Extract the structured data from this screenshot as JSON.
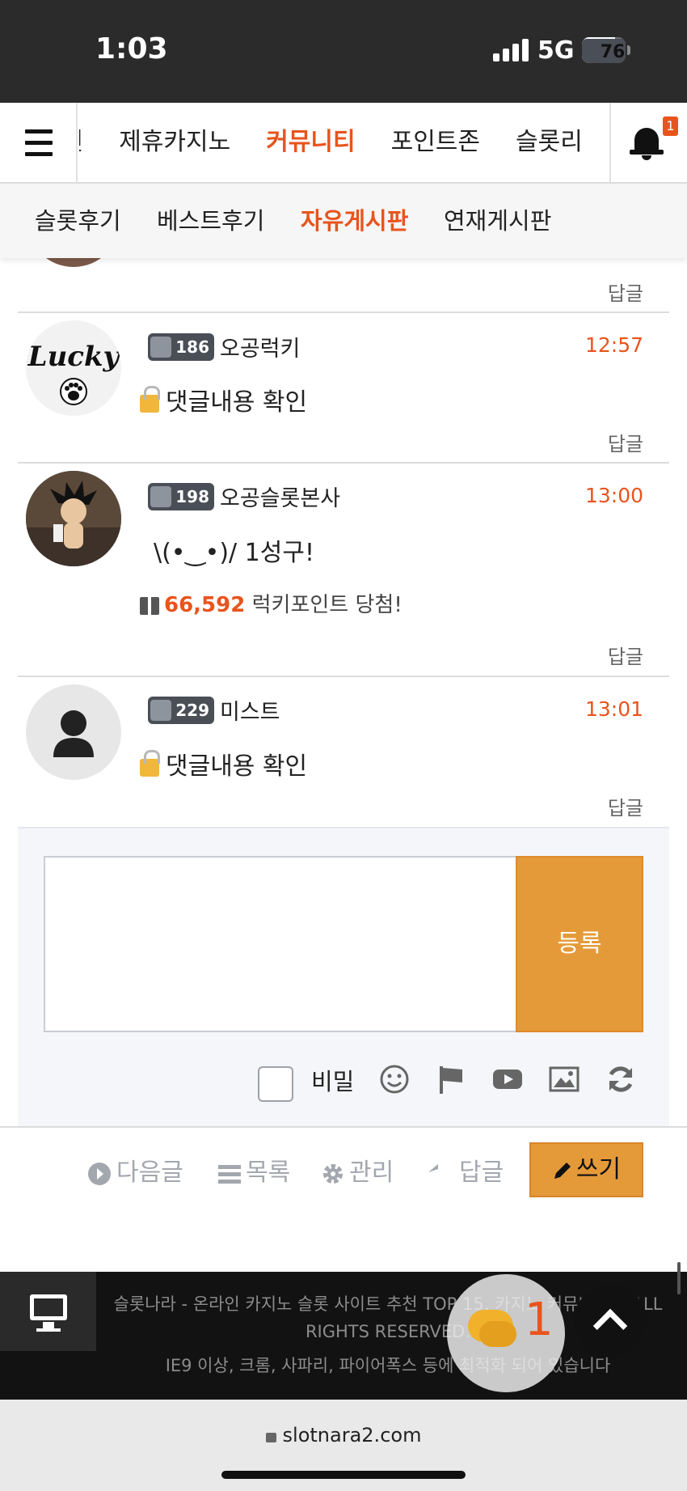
{
  "status": {
    "time": "1:03",
    "network": "5G",
    "battery": "76",
    "battery_level": 0.76
  },
  "nav": {
    "items": [
      "이인",
      "제휴카지노",
      "커뮤니티",
      "포인트존",
      "슬롯리"
    ],
    "active_index": 2,
    "notification_count": "1"
  },
  "subnav": {
    "items": [
      "슬롯후기",
      "베스트후기",
      "자유게시판",
      "연재게시판"
    ],
    "active_index": 2
  },
  "comments": [
    {
      "level": "186",
      "nickname": "오공럭키",
      "time": "12:57",
      "content": "댓글내용 확인",
      "locked": true,
      "reply": "답글"
    },
    {
      "level": "198",
      "nickname": "오공슬롯본사",
      "time": "13:00",
      "content": "\\(•‿•)/ 1성구!",
      "points": "66,592",
      "points_suffix": "럭키포인트 당첨!",
      "reply": "답글"
    },
    {
      "level": "229",
      "nickname": "미스트",
      "time": "13:01",
      "content": "댓글내용 확인",
      "locked": true,
      "reply": "답글"
    }
  ],
  "top_reply": "답글",
  "form": {
    "submit_label": "등록",
    "secret_label": "비밀",
    "textarea_placeholder": ""
  },
  "actions": {
    "next": "다음글",
    "list": "목록",
    "manage": "관리",
    "reply": "답글",
    "write": "쓰기"
  },
  "footer": {
    "line1": "슬롯나라 - 온라인 카지노 슬롯 사이트 추천 TOP 15, 카지노 커뮤니티 ©ALL",
    "line2": "RIGHTS RESERVED.",
    "line3": "IE9 이상, 크롬, 사파리, 파이어폭스 등에 최적화 되어 있습니다",
    "chat_count": "1"
  },
  "url": "slotnara2.com",
  "colors": {
    "accent": "#e8541c",
    "button": "#e59a3a",
    "dark": "#2b2b2b"
  }
}
